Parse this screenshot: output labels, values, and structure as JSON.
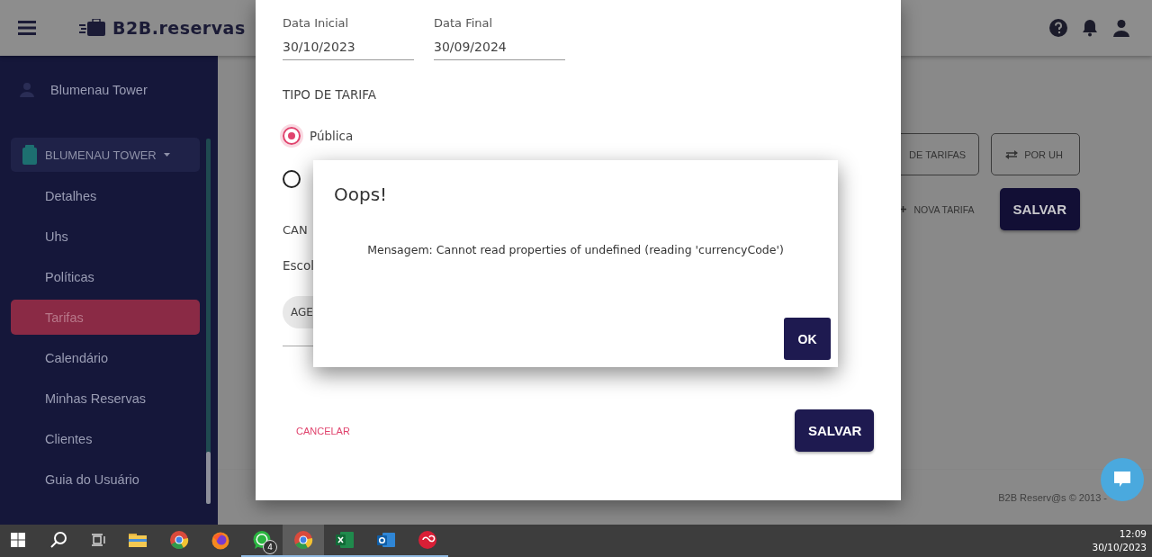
{
  "header": {
    "brand": "B2B.reservas"
  },
  "sidebar": {
    "account": "Blumenau Tower",
    "property": "BLUMENAU TOWER",
    "items": [
      {
        "label": "Detalhes",
        "selected": false
      },
      {
        "label": "Uhs",
        "selected": false
      },
      {
        "label": "Políticas",
        "selected": false
      },
      {
        "label": "Tarifas",
        "selected": true
      },
      {
        "label": "Calendário",
        "selected": false
      },
      {
        "label": "Minhas Reservas",
        "selected": false
      },
      {
        "label": "Clientes",
        "selected": false
      },
      {
        "label": "Guia do Usuário",
        "selected": false
      }
    ]
  },
  "main": {
    "top_buttons": [
      "DE TARIFAS",
      "POR UH"
    ],
    "new_rate": "NOVA TARIFA",
    "save": "SALVAR",
    "footer": "B2B Reserv@s © 2013 -"
  },
  "form": {
    "date_fields": [
      {
        "label": "Data Inicial",
        "value": "30/10/2023"
      },
      {
        "label": "Data Final",
        "value": "30/09/2024"
      }
    ],
    "rate_type_title": "TIPO DE TARIFA",
    "rate_types": [
      {
        "label": "Pública",
        "selected": true
      },
      {
        "selected": false
      }
    ],
    "channel_title": "CAN",
    "channel_hint": "Escol",
    "chips": [
      "AGE"
    ],
    "cancel": "CANCELAR",
    "save": "SALVAR"
  },
  "alert": {
    "title": "Oops!",
    "message": "Mensagem: Cannot read properties of undefined (reading 'currencyCode')",
    "ok": "OK"
  },
  "taskbar": {
    "apps": [
      {
        "kind": "folder",
        "running": false,
        "active": false
      },
      {
        "kind": "chrome",
        "running": false,
        "active": false
      },
      {
        "kind": "firefox",
        "running": false,
        "active": false
      },
      {
        "kind": "whatsapp",
        "running": true,
        "active": false,
        "badge": "4"
      },
      {
        "kind": "chrome",
        "running": true,
        "active": true
      },
      {
        "kind": "excel",
        "running": true,
        "active": false
      },
      {
        "kind": "outlook",
        "running": true,
        "active": false
      },
      {
        "kind": "creative-cloud",
        "running": true,
        "active": false
      }
    ],
    "time": "12:09",
    "date": "30/10/2023"
  }
}
